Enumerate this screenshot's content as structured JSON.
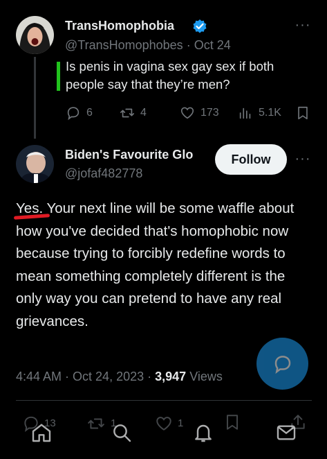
{
  "tweet1": {
    "display_name": "TransHomophobia",
    "handle": "@TransHomophobes",
    "date": "Oct 24",
    "text": "Is penis in vagina sex gay sex if both people say that they’re men?",
    "stats": {
      "replies": "6",
      "retweets": "4",
      "likes": "173",
      "views": "5.1K"
    }
  },
  "tweet2": {
    "display_name": "Biden's Favourite Glo",
    "handle": "@jofaf482778",
    "follow_label": "Follow",
    "text": "Yes. Your next line will be some waffle about how you've decided that's homophobic now because trying to forcibly redefine words to mean something completely different is the only way you can pretend to have any real grievances.",
    "time": "4:44 AM",
    "date": "Oct 24, 2023",
    "views_count": "3,947",
    "views_label": "Views",
    "stats": {
      "replies": "13",
      "retweets": "1",
      "likes": "1"
    }
  },
  "colors": {
    "background": "#000000",
    "text": "#e7e9ea",
    "muted": "#71767b",
    "accent": "#1d9bf0",
    "highlight_bar": "#21c21d",
    "underline_mark": "#e01b24"
  },
  "icons": {
    "verified": "verified-badge-icon",
    "more": "more-horizontal-icon",
    "reply": "reply-icon",
    "retweet": "retweet-icon",
    "like": "heart-icon",
    "views": "views-bar-icon",
    "bookmark": "bookmark-icon",
    "share": "share-icon",
    "compose": "compose-reply-icon",
    "nav": [
      "home-icon",
      "search-icon",
      "notifications-icon",
      "messages-icon"
    ]
  }
}
